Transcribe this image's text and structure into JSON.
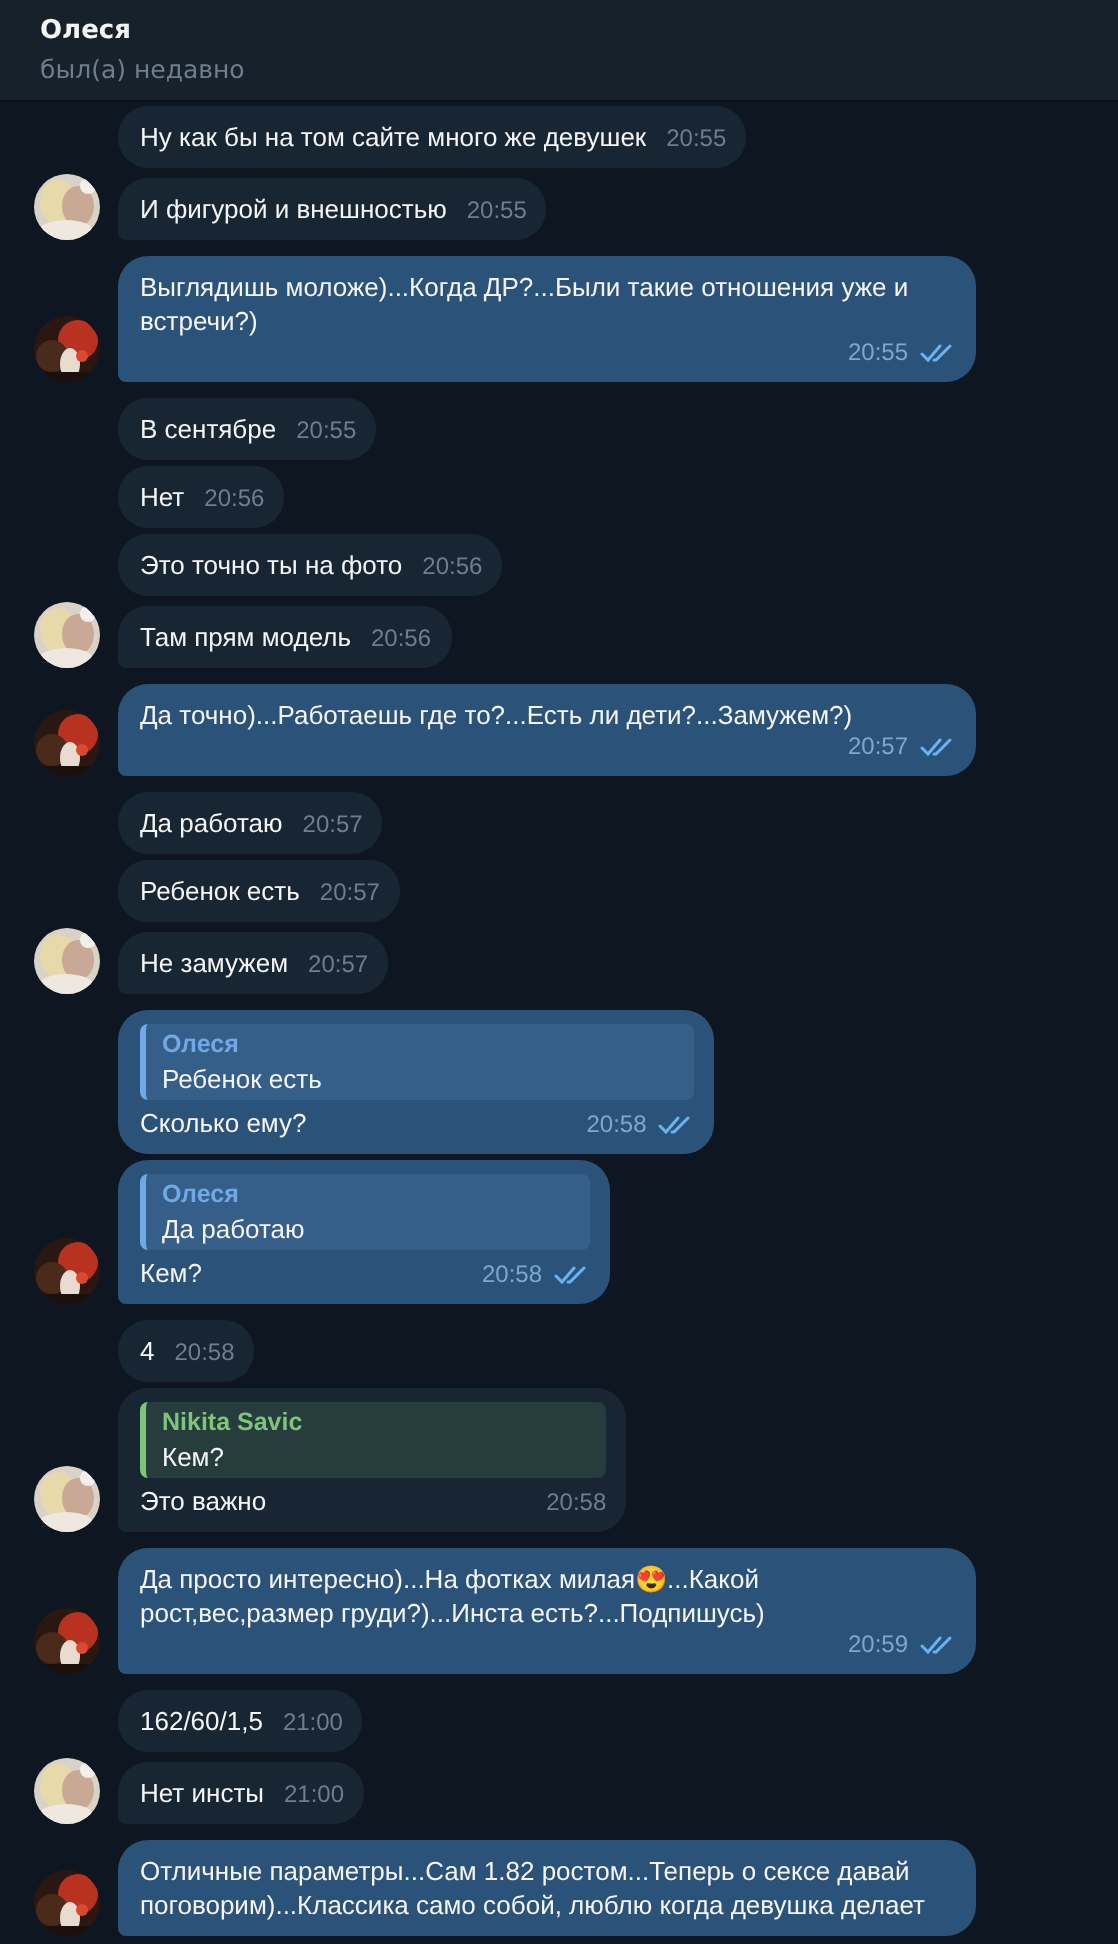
{
  "header": {
    "title": "Олеся",
    "status": "был(а) недавно"
  },
  "messages": [
    {
      "kind": "incoming",
      "text": "Ну как бы на том сайте много же девушек",
      "time": "20:55",
      "avatar": false
    },
    {
      "kind": "incoming",
      "text": "И фигурой и внешностью",
      "time": "20:55",
      "avatar": true
    },
    {
      "kind": "outgoing",
      "text": "Выглядишь моложе)...Когда ДР?...Были такие отношения уже и встречи?)",
      "time": "20:55",
      "avatar": true,
      "read": true
    },
    {
      "kind": "incoming",
      "text": "В сентябре",
      "time": "20:55",
      "avatar": false
    },
    {
      "kind": "incoming",
      "text": "Нет",
      "time": "20:56",
      "avatar": false
    },
    {
      "kind": "incoming",
      "text": "Это точно ты на фото",
      "time": "20:56",
      "avatar": false
    },
    {
      "kind": "incoming",
      "text": "Там прям модель",
      "time": "20:56",
      "avatar": true
    },
    {
      "kind": "outgoing",
      "text": "Да точно)...Работаешь где то?...Есть ли дети?...Замужем?)",
      "time": "20:57",
      "avatar": true,
      "read": true
    },
    {
      "kind": "incoming",
      "text": "Да работаю",
      "time": "20:57",
      "avatar": false
    },
    {
      "kind": "incoming",
      "text": "Ребенок есть",
      "time": "20:57",
      "avatar": false
    },
    {
      "kind": "incoming",
      "text": "Не замужем",
      "time": "20:57",
      "avatar": true
    },
    {
      "kind": "outgoing",
      "reply": {
        "author": "Олеся",
        "text": "Ребенок есть",
        "color": "#71a9e6"
      },
      "text": "Сколько ему?",
      "time": "20:58",
      "avatar": false,
      "read": true
    },
    {
      "kind": "outgoing",
      "reply": {
        "author": "Олеся",
        "text": "Да работаю",
        "color": "#71a9e6"
      },
      "text": "Кем?",
      "time": "20:58",
      "avatar": true,
      "read": true
    },
    {
      "kind": "incoming",
      "text": "4",
      "time": "20:58",
      "avatar": false
    },
    {
      "kind": "incoming",
      "reply": {
        "author": "Nikita Savic",
        "text": "Кем?",
        "color": "#7fc47a"
      },
      "text": "Это важно",
      "time": "20:58",
      "avatar": true
    },
    {
      "kind": "outgoing",
      "text": "Да просто интересно)...На фотках милая😍...Какой рост,вес,размер груди?)...Инста есть?...Подпишусь)",
      "time": "20:59",
      "avatar": true,
      "read": true
    },
    {
      "kind": "incoming",
      "text": "162/60/1,5",
      "time": "21:00",
      "avatar": false
    },
    {
      "kind": "incoming",
      "text": "Нет инсты",
      "time": "21:00",
      "avatar": true
    },
    {
      "kind": "outgoing",
      "text": "Отличные параметры...Сам 1.82 ростом...Теперь о сексе давай поговорим)...Классика само собой, люблю когда девушка делает",
      "avatar": true
    }
  ]
}
